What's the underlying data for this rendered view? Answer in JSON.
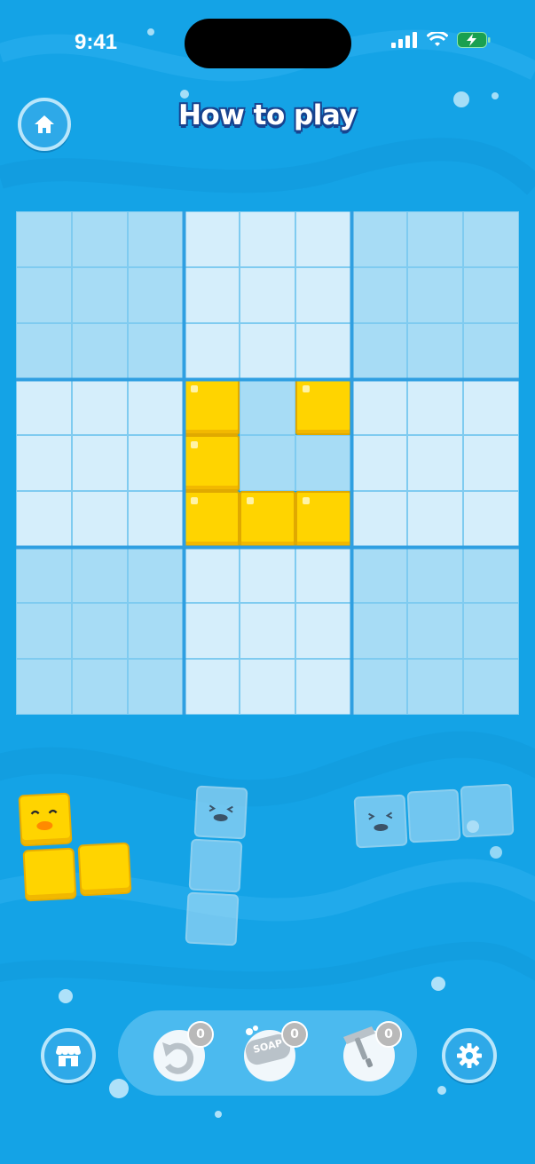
{
  "status_bar": {
    "time": "9:41"
  },
  "header": {
    "title": "How to play",
    "home_icon": "home-icon"
  },
  "board": {
    "rows": 9,
    "cols": 9,
    "filled_cells": [
      [
        3,
        3
      ],
      [
        3,
        5
      ],
      [
        4,
        3
      ],
      [
        5,
        3
      ],
      [
        5,
        4
      ],
      [
        5,
        5
      ]
    ],
    "filled_color": "#ffd400"
  },
  "pieces": [
    {
      "name": "l-piece-duck",
      "style": "yellow"
    },
    {
      "name": "vertical-3-piece",
      "style": "ghost"
    },
    {
      "name": "horizontal-3-piece",
      "style": "ghost"
    }
  ],
  "toolbar": {
    "shop_icon": "shop-icon",
    "undo": {
      "icon": "undo-icon",
      "count": "0"
    },
    "soap": {
      "icon": "soap-icon",
      "label": "SOAP",
      "count": "0"
    },
    "squeegee": {
      "icon": "squeegee-icon",
      "count": "0"
    },
    "settings_icon": "gear-icon"
  },
  "colors": {
    "background": "#14a3e6",
    "title_outline": "#17438f",
    "accent_yellow": "#ffd400"
  }
}
